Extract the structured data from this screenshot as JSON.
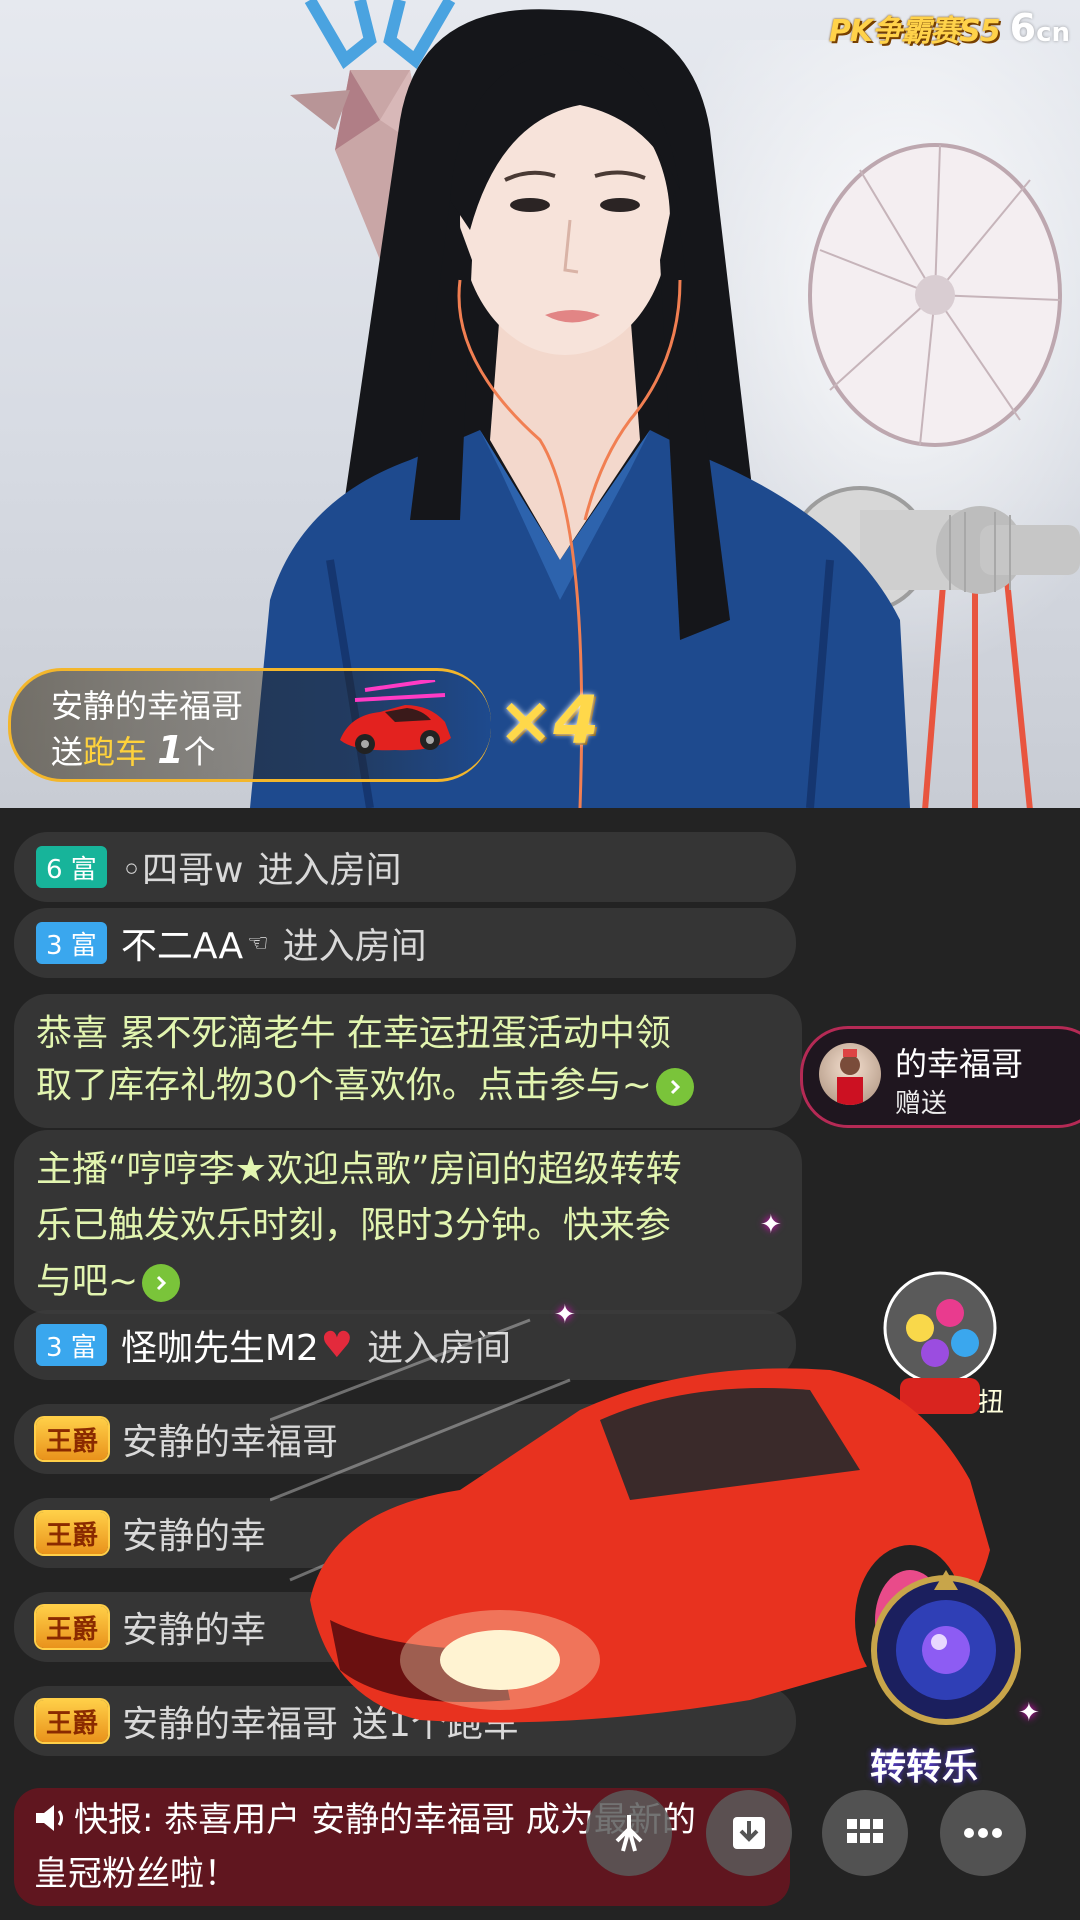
{
  "brand": {
    "event_logo": "PK争霸赛S5",
    "site_logo": "6",
    "site_logo_suffix": "cn"
  },
  "gift_banner": {
    "sender": "安静的幸福哥",
    "send_word": "送",
    "gift_name": "跑车",
    "count": "1",
    "unit": "个",
    "multiplier": "×4"
  },
  "chat": [
    {
      "badge": "6 富",
      "badge_color": "#17b49a",
      "user": "◦四哥w",
      "action": "进入房间"
    },
    {
      "badge": "3 富",
      "badge_color": "#3aa7ee",
      "user": "不二AA",
      "action": "进入房间"
    },
    {
      "text_line1": "恭喜 累不死滴老牛  在幸运扭蛋活动中领",
      "text_line2": "取了库存礼物30个喜欢你。点击参与~"
    },
    {
      "text_line1": "主播“哼哼李★欢迎点歌”房间的超级转转",
      "text_line2": "乐已触发欢乐时刻，限时3分钟。快来参",
      "text_line3": "与吧~"
    },
    {
      "badge": "3 富",
      "badge_color": "#3aa7ee",
      "user": "怪咖先生M2",
      "action": "进入房间"
    },
    {
      "badge": "王爵",
      "user": "安静的幸福哥"
    },
    {
      "badge": "王爵",
      "user": "安静的幸"
    },
    {
      "badge": "王爵",
      "user": "安静的幸"
    },
    {
      "badge": "王爵",
      "user": "安静的幸福哥",
      "action": "送1个跑车"
    }
  ],
  "follow_card": {
    "name": "的幸福哥",
    "sub": "赠送"
  },
  "gasha_label": "扭",
  "spin_widget": {
    "label": "转转乐"
  },
  "news": {
    "prefix": "快报:",
    "text_line1": " 恭喜用户 安静的幸福哥 成为最新的",
    "text_line2": "皇冠粉丝啦！"
  },
  "buttons": [
    {
      "name": "share-icon"
    },
    {
      "name": "download-icon"
    },
    {
      "name": "grid-menu-icon"
    },
    {
      "name": "more-icon"
    }
  ]
}
